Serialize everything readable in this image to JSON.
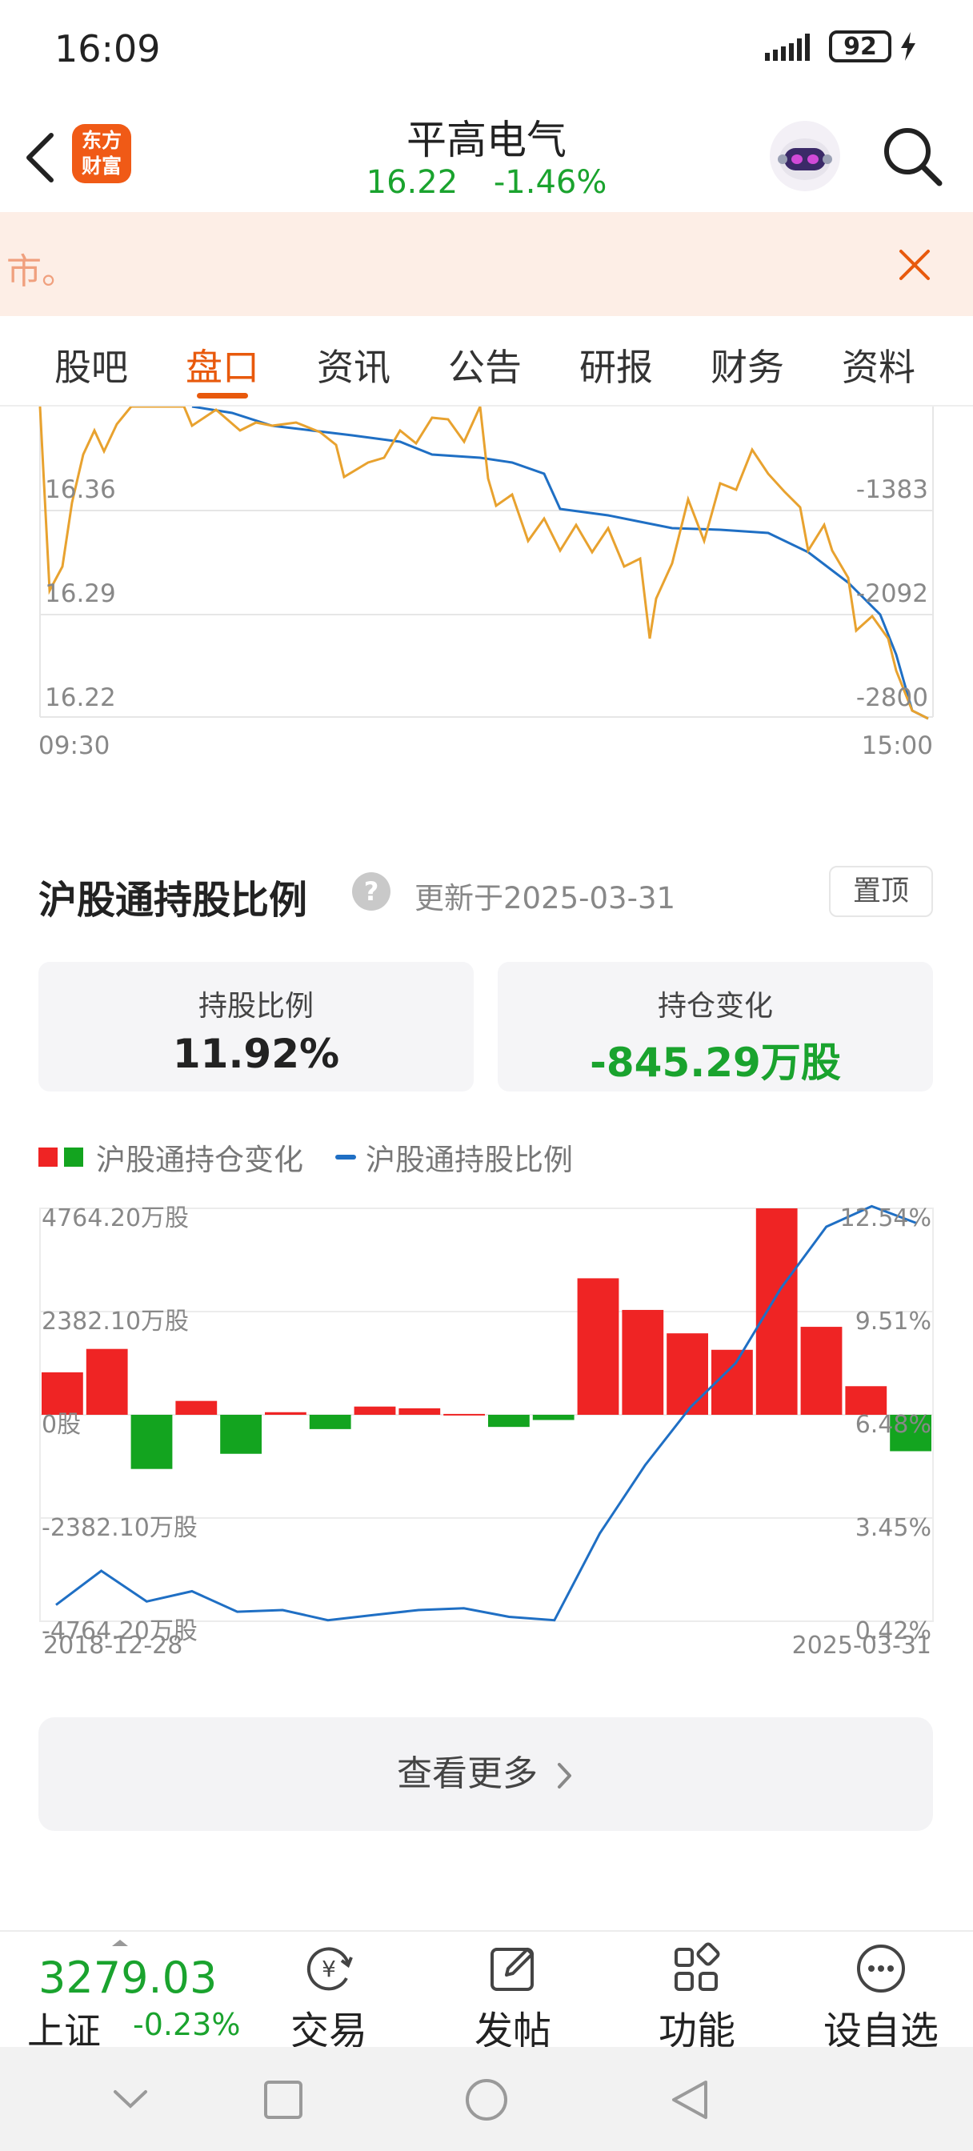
{
  "status_bar": {
    "time": "16:09",
    "battery": "92"
  },
  "header": {
    "logo_line1": "东方",
    "logo_line2": "财富",
    "stock_name": "平高电气",
    "price": "16.22",
    "change_pct": "-1.46%"
  },
  "banner": {
    "text": "市。"
  },
  "tabs": [
    {
      "label": "股吧"
    },
    {
      "label": "盘口"
    },
    {
      "label": "资讯"
    },
    {
      "label": "公告"
    },
    {
      "label": "研报"
    },
    {
      "label": "财务"
    },
    {
      "label": "资料"
    }
  ],
  "active_tab": "盘口",
  "intraday": {
    "y_left": [
      "16.36",
      "16.29",
      "16.22"
    ],
    "y_right": [
      "-1383",
      "-2092",
      "-2800"
    ],
    "x_start": "09:30",
    "x_end": "15:00"
  },
  "holding": {
    "title": "沪股通持股比例",
    "update": "更新于2025-03-31",
    "pin_label": "置顶",
    "ratio_label": "持股比例",
    "ratio_value": "11.92%",
    "change_label": "持仓变化",
    "change_value": "-845.29万股",
    "legend_bar": "沪股通持仓变化",
    "legend_line": "沪股通持股比例",
    "more_label": "查看更多"
  },
  "chart_data": {
    "type": "bar",
    "x_start": "2018-12-28",
    "x_end": "2025-03-31",
    "y_left_ticks": [
      "4764.20万股",
      "2382.10万股",
      "0股",
      "-2382.10万股",
      "-4764.20万股"
    ],
    "y_right_ticks": [
      "12.54%",
      "9.51%",
      "6.48%",
      "3.45%",
      "0.42%"
    ],
    "ylim_left": [
      -4764.2,
      4764.2
    ],
    "ylim_right": [
      0.42,
      12.54
    ],
    "colors": {
      "up": "#ef2424",
      "down": "#13a41f",
      "line": "#1f6fc4"
    },
    "series": [
      {
        "name": "沪股通持仓变化",
        "values": [
          980,
          1520,
          -1250,
          320,
          -900,
          60,
          -330,
          190,
          150,
          20,
          -280,
          -120,
          3150,
          2420,
          1880,
          1500,
          4764,
          2030,
          660,
          -840
        ]
      },
      {
        "name": "沪股通持股比例",
        "values": [
          0.9,
          1.9,
          1.0,
          1.3,
          0.7,
          0.75,
          0.45,
          0.6,
          0.75,
          0.8,
          0.55,
          0.45,
          3.0,
          5.0,
          6.7,
          8.0,
          10.2,
          12.0,
          12.6,
          12.1
        ]
      }
    ]
  },
  "bottom_nav": {
    "index_value": "3279.03",
    "index_name": "上证",
    "index_change": "-0.23%",
    "items": [
      {
        "label": "交易"
      },
      {
        "label": "发帖"
      },
      {
        "label": "功能"
      },
      {
        "label": "设自选"
      }
    ]
  }
}
